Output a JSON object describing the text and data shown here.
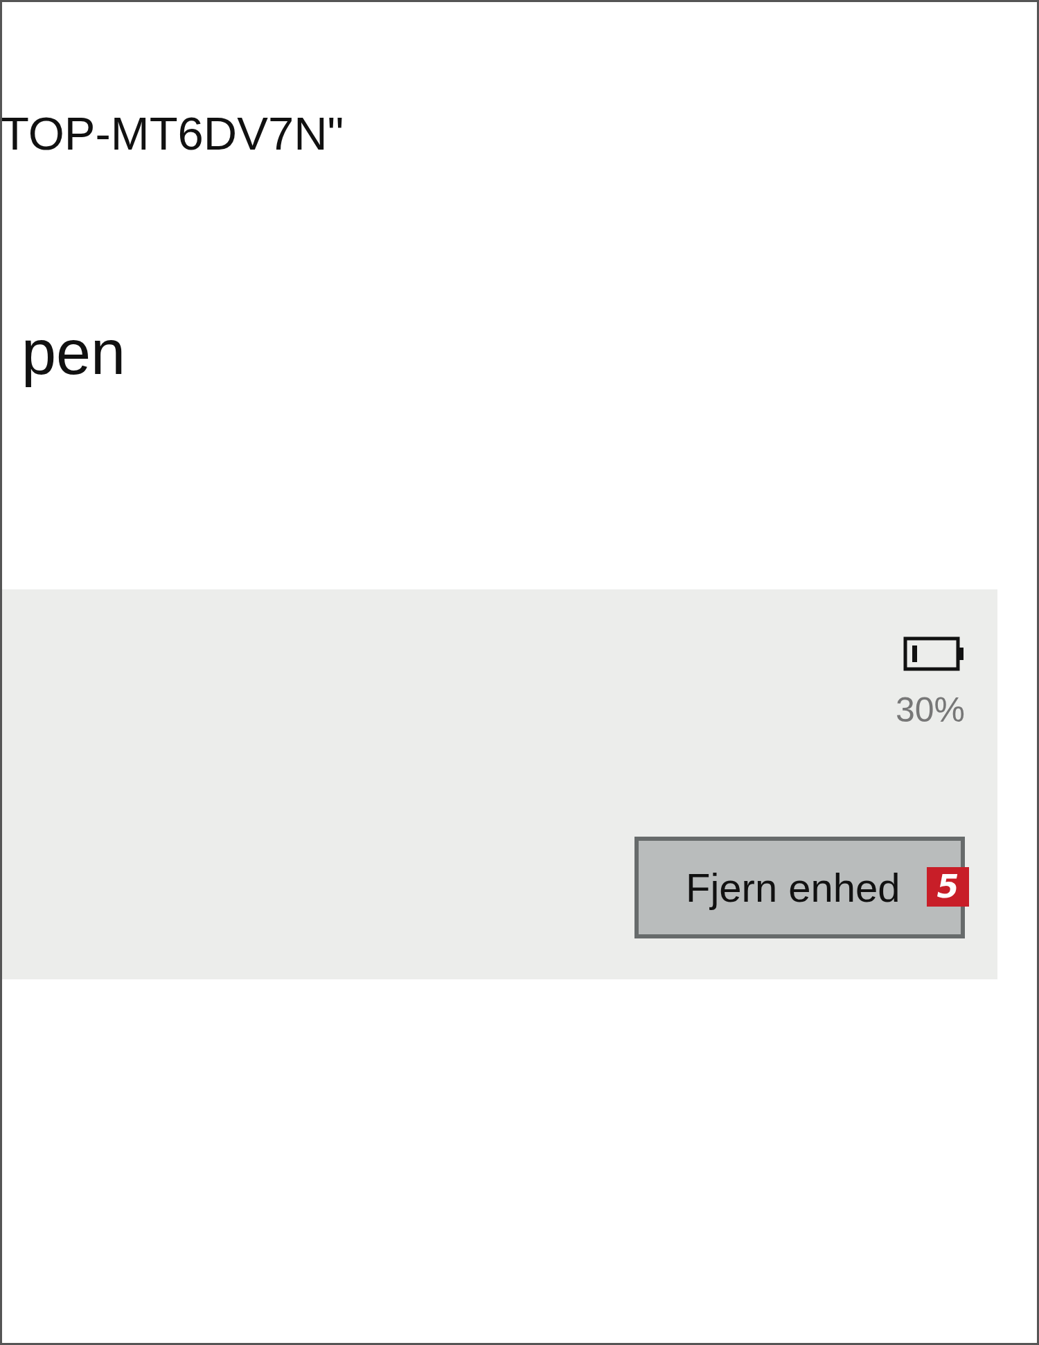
{
  "device_name": "TOP-MT6DV7N\"",
  "section_title": "pen",
  "device_panel": {
    "battery_reading": "30%",
    "remove_button": {
      "label": "Fjern enhed",
      "badge": "5"
    }
  }
}
